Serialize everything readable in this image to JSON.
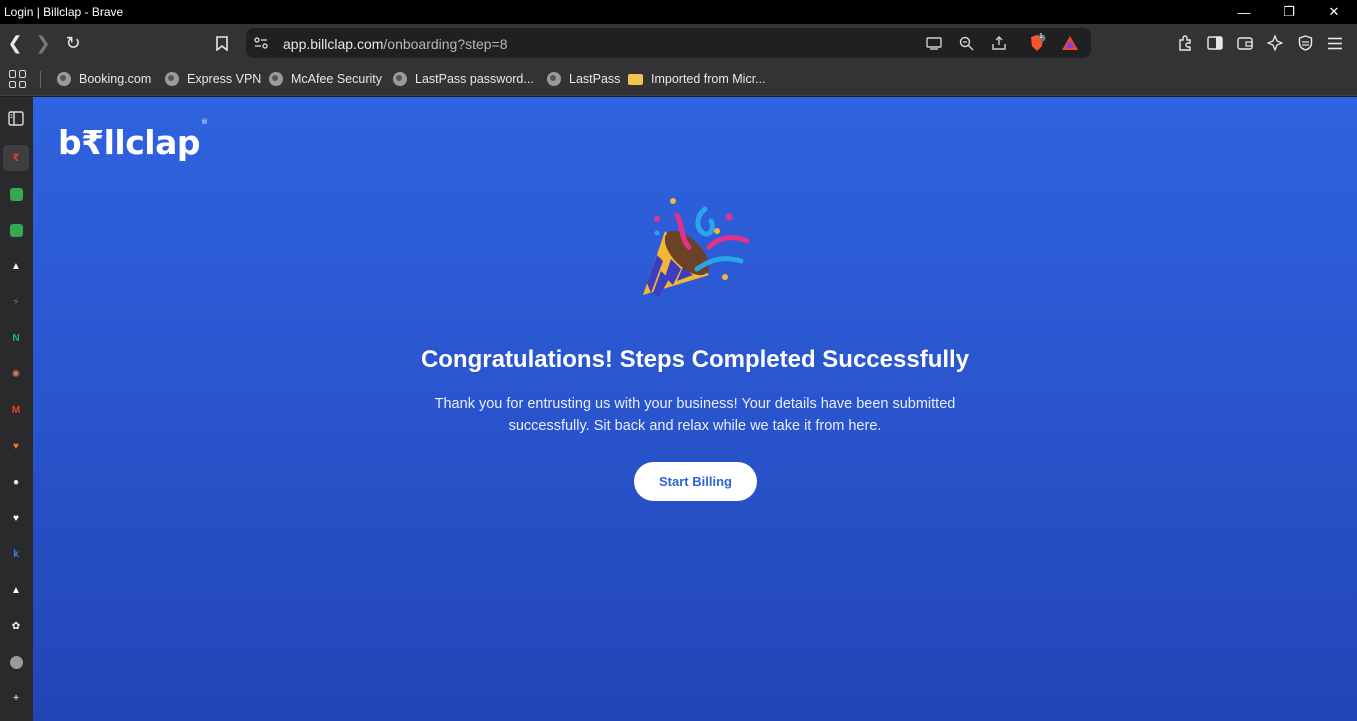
{
  "window": {
    "title": "Login | Billclap - Brave",
    "minimize_glyph": "—",
    "restore_glyph": "❐",
    "close_glyph": "✕"
  },
  "toolbar": {
    "back_glyph": "❮",
    "forward_glyph": "❯",
    "reload_glyph": "↻",
    "bookmark_glyph": "⌑",
    "url_host": "app.billclap.com",
    "url_path": "/onboarding?step=8",
    "shields_count": "1"
  },
  "bookmarks": [
    {
      "label": "Booking.com",
      "icon": "globe-icon"
    },
    {
      "label": "Express VPN",
      "icon": "globe-icon"
    },
    {
      "label": "McAfee Security",
      "icon": "globe-icon"
    },
    {
      "label": "LastPass password...",
      "icon": "globe-icon"
    },
    {
      "label": "LastPass",
      "icon": "globe-icon"
    },
    {
      "label": "Imported from Micr...",
      "icon": "folder-icon"
    }
  ],
  "sidebar_items": [
    {
      "name": "rupee-app-icon",
      "color": "#e53935",
      "glyph": "₹"
    },
    {
      "name": "google-meet-icon",
      "color": "#34a853",
      "glyph": ""
    },
    {
      "name": "google-meet-icon-2",
      "color": "#34a853",
      "glyph": ""
    },
    {
      "name": "triangle-app-icon",
      "color": "#ffffff",
      "glyph": "▲"
    },
    {
      "name": "bolt-app-icon",
      "color": "#16a34a",
      "glyph": "⚡"
    },
    {
      "name": "n-app-icon",
      "color": "#10b981",
      "glyph": "N"
    },
    {
      "name": "claude-icon",
      "color": "#d97757",
      "glyph": "✺"
    },
    {
      "name": "gmail-icon",
      "color": "#ea4335",
      "glyph": "M"
    },
    {
      "name": "heart-app-icon",
      "color": "#f97316",
      "glyph": "♥"
    },
    {
      "name": "github-icon",
      "color": "#ffffff",
      "glyph": "●"
    },
    {
      "name": "heart-white-icon",
      "color": "#ffffff",
      "glyph": "♥"
    },
    {
      "name": "k-app-icon",
      "color": "#3b82f6",
      "glyph": "k"
    },
    {
      "name": "triangle-app-icon-2",
      "color": "#ffffff",
      "glyph": "▲"
    },
    {
      "name": "openai-icon",
      "color": "#ffffff",
      "glyph": "✿"
    },
    {
      "name": "globe-app-icon",
      "color": "#9a9a9a",
      "glyph": ""
    },
    {
      "name": "add-icon",
      "color": "#cccccc",
      "glyph": "+"
    }
  ],
  "page": {
    "logo_text": "b₹llclap",
    "logo_mark": "®",
    "heading": "Congratulations! Steps Completed Successfully",
    "subtext": "Thank you for entrusting us with your business! Your details have been submitted successfully. Sit back and relax while we take it from here.",
    "button_label": "Start Billing"
  },
  "colors": {
    "accent": "#2e62d9",
    "background_top": "#2f63df",
    "background_bottom": "#2245b6"
  }
}
